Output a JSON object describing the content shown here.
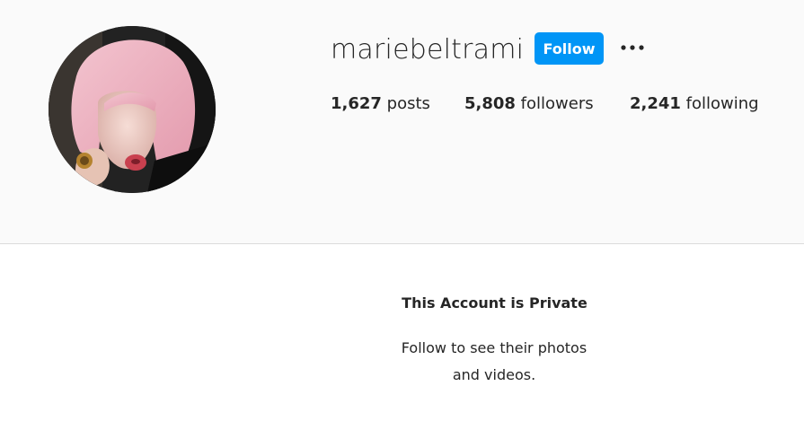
{
  "profile": {
    "username": "mariebeltrami",
    "follow_label": "Follow",
    "avatar_icon": "profile-avatar",
    "more_icon": "more-options-icon"
  },
  "stats": {
    "posts": {
      "count": "1,627",
      "label": "posts"
    },
    "followers": {
      "count": "5,808",
      "label": "followers"
    },
    "following": {
      "count": "2,241",
      "label": "following"
    }
  },
  "private": {
    "title": "This Account is Private",
    "message": "Follow to see their photos and videos."
  },
  "colors": {
    "accent": "#0095f6",
    "background": "#fafafa",
    "divider": "#dbdbdb"
  }
}
